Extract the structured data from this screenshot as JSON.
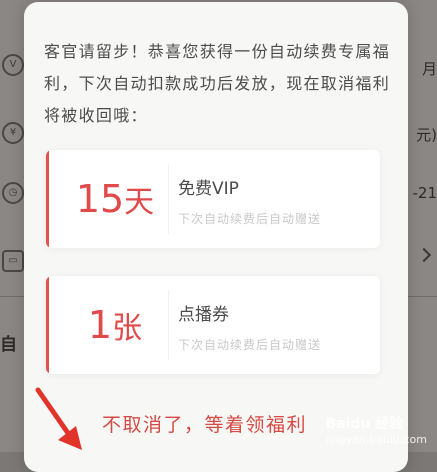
{
  "background": {
    "left_fragment": "自",
    "right_fragments": [
      "月",
      "元)",
      "-21"
    ],
    "icons": [
      "v-icon",
      "yen-icon",
      "clock-icon",
      "card-icon"
    ]
  },
  "dialog": {
    "message": "客官请留步！恭喜您获得一份自动续费专属福利，下次自动扣款成功后发放，现在取消福利将被收回哦：",
    "benefits": [
      {
        "value_num": "15",
        "value_unit": "天",
        "title": "免费VIP",
        "subtitle": "下次自动续费后自动赠送"
      },
      {
        "value_num": "1",
        "value_unit": "张",
        "title": "点播券",
        "subtitle": "下次自动续费后自动赠送"
      }
    ],
    "keep_button": "不取消了，等着领福利"
  },
  "watermark": {
    "text": "Baidu 经验",
    "url": "jingyan.baidu.com"
  },
  "colors": {
    "accent": "#e04a4a",
    "overlay": "#8a8784",
    "dialog_bg": "#f7f7f6"
  }
}
